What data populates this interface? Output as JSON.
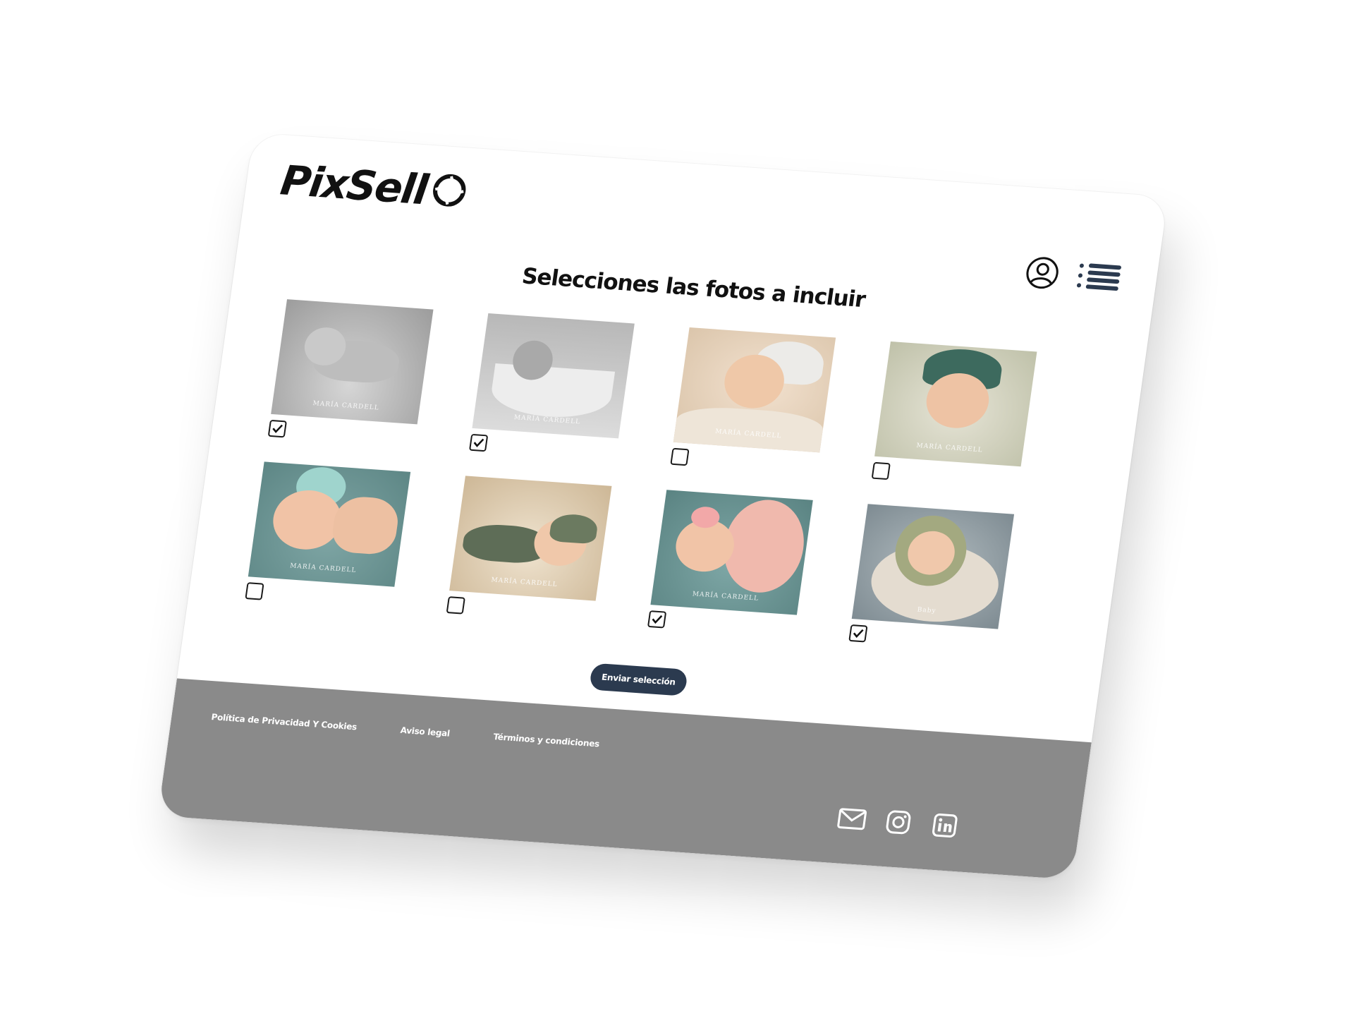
{
  "brand": {
    "name": "PixSell",
    "logo_icon": "camera-aperture-icon"
  },
  "header": {
    "user_icon": "user-circle-icon",
    "menu_icon": "menu-list-icon"
  },
  "page": {
    "title": "Selecciones las fotos a incluir"
  },
  "photos": [
    {
      "watermark": "MARÍA CARDELL",
      "selected": true
    },
    {
      "watermark": "MARÍA CARDELL",
      "selected": true
    },
    {
      "watermark": "MARÍA CARDELL",
      "selected": false
    },
    {
      "watermark": "MARÍA CARDELL",
      "selected": false
    },
    {
      "watermark": "MARÍA CARDELL",
      "selected": false
    },
    {
      "watermark": "MARÍA CARDELL",
      "selected": false
    },
    {
      "watermark": "MARÍA CARDELL",
      "selected": true
    },
    {
      "watermark": "Baby",
      "selected": true
    }
  ],
  "actions": {
    "submit_label": "Enviar selección"
  },
  "footer": {
    "links": [
      "Política de Privacidad Y Cookies",
      "Aviso legal",
      "Términos y condiciones"
    ],
    "social_icons": [
      "mail-icon",
      "instagram-icon",
      "linkedin-icon"
    ]
  },
  "colors": {
    "primary": "#2b3a4f",
    "footer_bg": "#8a8a8a",
    "text": "#111111"
  }
}
